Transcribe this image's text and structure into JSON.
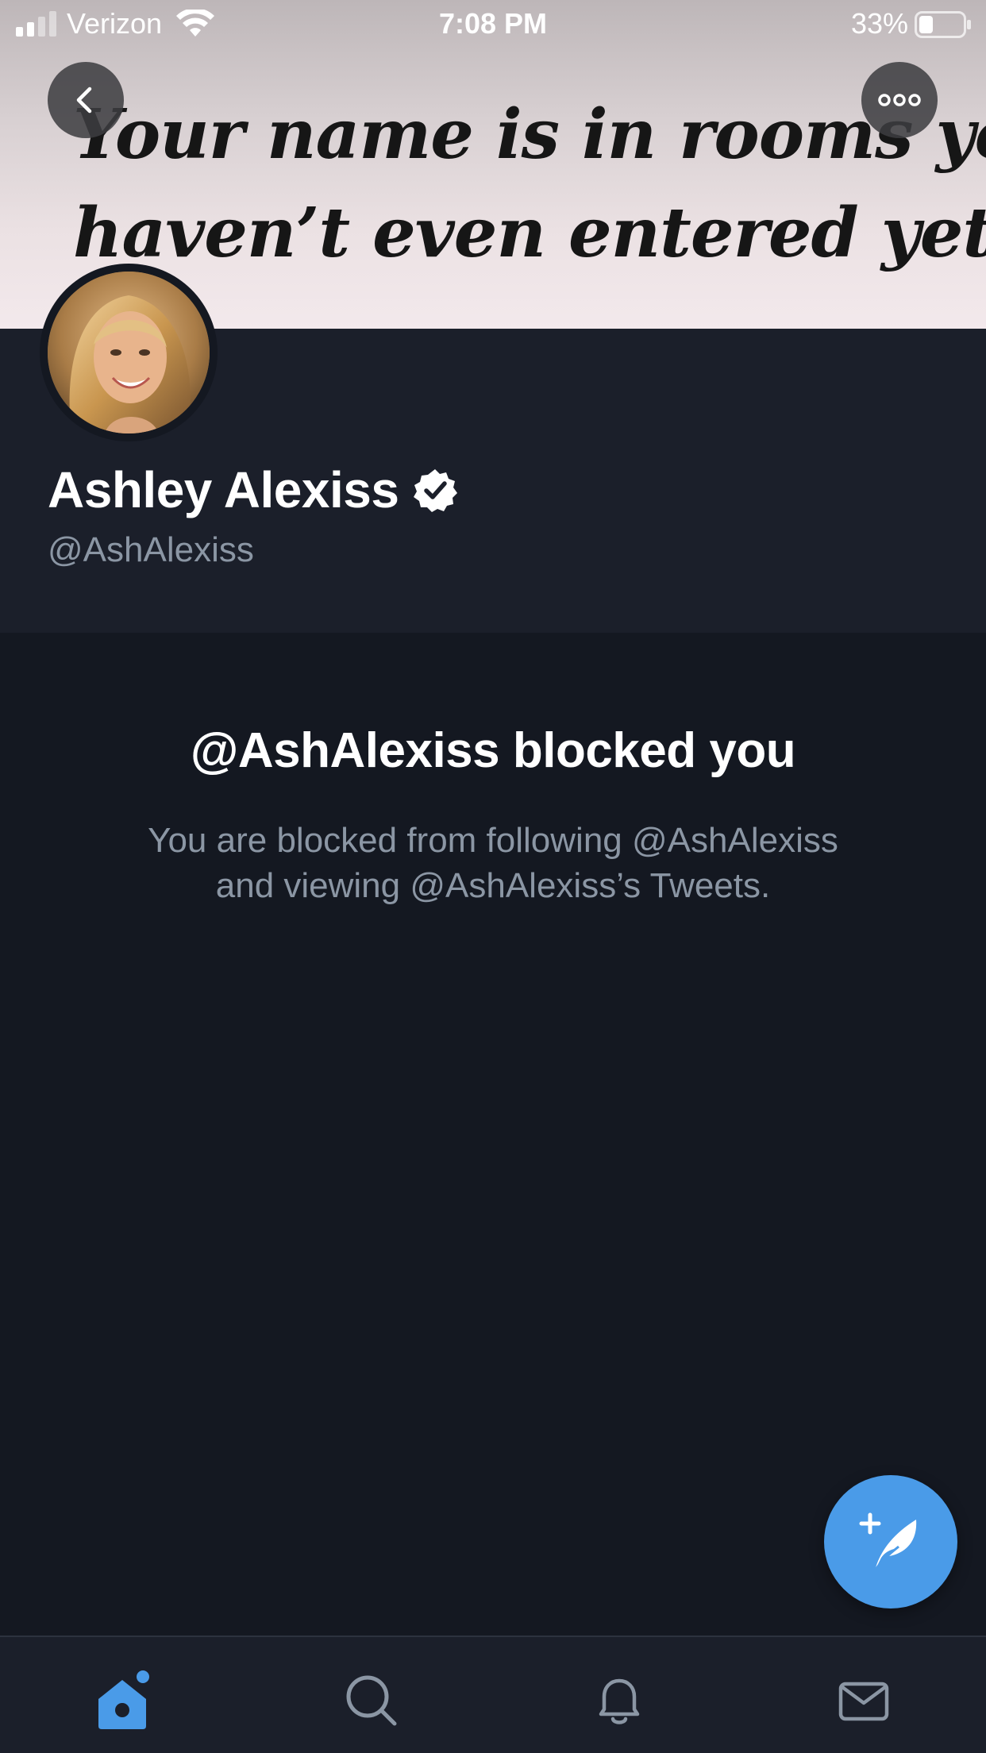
{
  "status_bar": {
    "carrier": "Verizon",
    "time": "7:08 PM",
    "battery_percent": "33%",
    "battery_level": 0.33,
    "signal_bars": 2,
    "signal_icon": "cellular-signal-icon",
    "wifi_icon": "wifi-icon",
    "battery_icon": "battery-icon"
  },
  "header": {
    "banner_quote_line1": "Your name is in rooms you",
    "banner_quote_line2": "haven’t even entered yet.",
    "back_icon": "chevron-left-icon",
    "more_icon": "more-options-icon"
  },
  "profile": {
    "display_name": "Ashley Alexiss",
    "handle": "@AshAlexiss",
    "verified": true,
    "verified_icon": "verified-badge-icon",
    "avatar_icon": "profile-avatar"
  },
  "blocked_notice": {
    "title": "@AshAlexiss blocked you",
    "description_line1": "You are blocked from following @AshAlexiss",
    "description_line2": "and viewing @AshAlexiss’s Tweets."
  },
  "compose": {
    "icon": "compose-tweet-icon"
  },
  "tab_bar": {
    "tabs": [
      {
        "name": "home",
        "icon": "home-icon",
        "active": true,
        "has_notification_dot": true
      },
      {
        "name": "search",
        "icon": "search-icon",
        "active": false
      },
      {
        "name": "notifications",
        "icon": "bell-icon",
        "active": false
      },
      {
        "name": "messages",
        "icon": "mail-icon",
        "active": false
      }
    ]
  },
  "colors": {
    "background": "#141821",
    "profile_background": "#1b1f2a",
    "accent": "#4a9be8",
    "secondary_text": "#8b96a4",
    "primary_text": "#ffffff"
  }
}
